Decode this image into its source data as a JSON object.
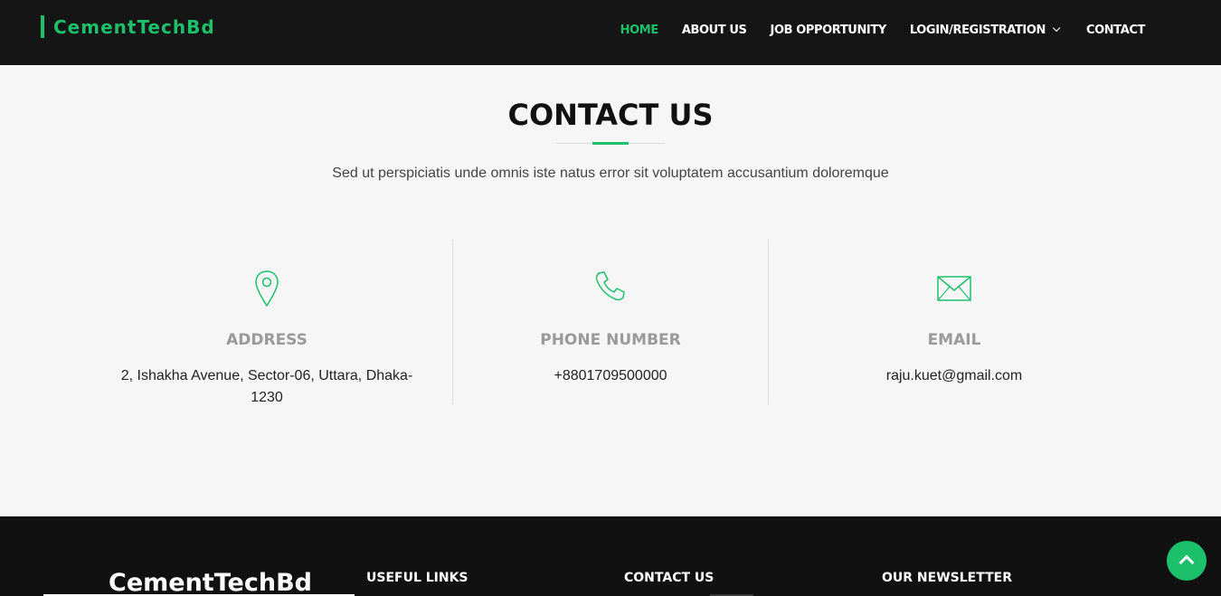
{
  "header": {
    "brand": "CementTechBd",
    "nav": [
      "HOME",
      "ABOUT US",
      "JOB OPPORTUNITY",
      "LOGIN/REGISTRATION",
      "CONTACT"
    ]
  },
  "section": {
    "title": "CONTACT US",
    "subtitle": "Sed ut perspiciatis unde omnis iste natus error sit voluptatem accusantium doloremque"
  },
  "cards": [
    {
      "icon": "map-pin-icon",
      "title": "ADDRESS",
      "text": "2, Ishakha Avenue, Sector-06, Uttara, Dhaka-1230"
    },
    {
      "icon": "phone-icon",
      "title": "PHONE NUMBER",
      "text": "+8801709500000"
    },
    {
      "icon": "envelope-icon",
      "title": "EMAIL",
      "text": "raju.kuet@gmail.com"
    }
  ],
  "footer": {
    "brand": "CementTechBd",
    "headings": [
      "USEFUL LINKS",
      "CONTACT US",
      "OUR NEWSLETTER"
    ]
  },
  "colors": {
    "accent": "#1cc06b",
    "dark": "#151515"
  }
}
